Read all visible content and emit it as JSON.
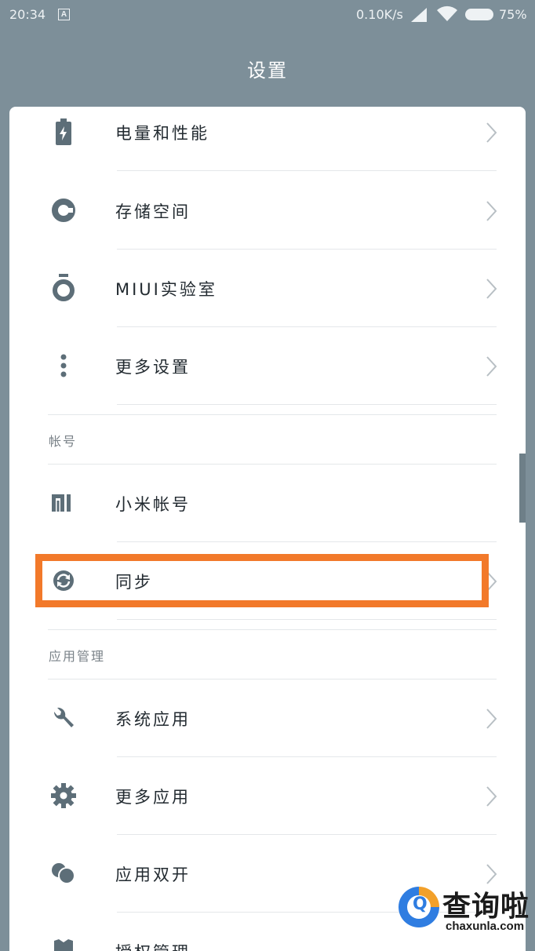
{
  "status_bar": {
    "time": "20:34",
    "notification_badge": "A",
    "net_speed": "0.10K/s",
    "battery_percent": "75%",
    "icons": [
      "signal-icon",
      "wifi-icon",
      "battery-icon"
    ]
  },
  "header": {
    "title": "设置"
  },
  "sections": {
    "top_items": [
      {
        "label": "电量和性能",
        "icon": "battery-icon"
      },
      {
        "label": "存储空间",
        "icon": "storage-pie-icon"
      },
      {
        "label": "MIUI实验室",
        "icon": "lab-flask-icon"
      },
      {
        "label": "更多设置",
        "icon": "more-dots-icon"
      }
    ],
    "account": {
      "header": "帐号",
      "items": [
        {
          "label": "小米帐号",
          "icon": "mi-logo-icon"
        },
        {
          "label": "同步",
          "icon": "sync-icon"
        }
      ]
    },
    "apps": {
      "header": "应用管理",
      "items": [
        {
          "label": "系统应用",
          "icon": "wrench-icon"
        },
        {
          "label": "更多应用",
          "icon": "gear-icon"
        },
        {
          "label": "应用双开",
          "icon": "dual-app-icon"
        },
        {
          "label": "授权管理",
          "icon": "shield-icon"
        }
      ]
    }
  },
  "highlight": {
    "target": "同步",
    "color": "#f2792a"
  },
  "colors": {
    "background": "#7d8f99",
    "card": "#ffffff",
    "icon": "#5d6e78",
    "text": "#222a30",
    "section_header": "#7a8288",
    "highlight": "#f2792a"
  },
  "watermark": {
    "title": "查询啦",
    "subtitle": "chaxunla.com"
  }
}
